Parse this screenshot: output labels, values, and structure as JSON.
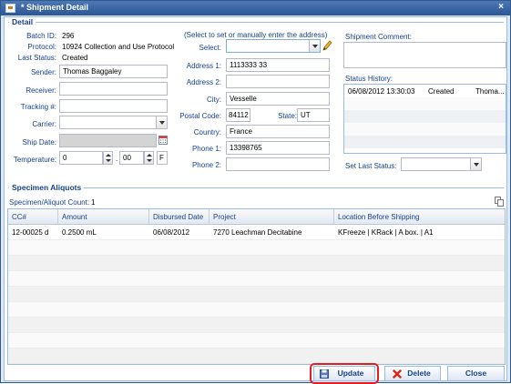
{
  "window": {
    "title": "* Shipment Detail",
    "close": "×"
  },
  "detail": {
    "legend": "Detail",
    "batch": {
      "label": "Batch ID:",
      "value": "296"
    },
    "protocol": {
      "label": "Protocol:",
      "value": "10924 Collection and Use Protocol"
    },
    "last_status": {
      "label": "Last Status:",
      "value": "Created"
    },
    "sender": {
      "label": "Sender:",
      "value": "Thomas Baggaley"
    },
    "receiver": {
      "label": "Receiver:",
      "value": ""
    },
    "tracking": {
      "label": "Tracking #:",
      "value": ""
    },
    "carrier": {
      "label": "Carrier:",
      "value": ""
    },
    "ship_date": {
      "label": "Ship Date:",
      "value": ""
    },
    "temperature": {
      "label": "Temperature:",
      "whole": "0",
      "dot": ".",
      "fraction": "00",
      "unit": "F"
    },
    "address_hint": "(Select to set or manually enter the address)",
    "select": {
      "label": "Select:",
      "value": ""
    },
    "address1": {
      "label": "Address 1:",
      "value": "1113333 33"
    },
    "address2": {
      "label": "Address 2:",
      "value": ""
    },
    "city": {
      "label": "City:",
      "value": "Vesselle"
    },
    "postal": {
      "label": "Postal Code:",
      "value": "84112"
    },
    "state": {
      "label": "State:",
      "value": "UT"
    },
    "country": {
      "label": "Country:",
      "value": "France"
    },
    "phone1": {
      "label": "Phone 1:",
      "value": "13398765"
    },
    "phone2": {
      "label": "Phone 2:",
      "value": ""
    },
    "shipment_comment": {
      "label": "Shipment Comment:",
      "value": ""
    },
    "status_history": {
      "label": "Status History:",
      "rows": [
        {
          "date": "06/08/2012 13:30:03",
          "status": "Created",
          "user": "Thoma..."
        }
      ]
    },
    "set_last_status": {
      "label": "Set Last Status:",
      "value": ""
    }
  },
  "aliquots": {
    "legend": "Specimen Aliquots",
    "count_label": "Specimen/Aliquot Count:",
    "count_value": "1",
    "columns": [
      "CC#",
      "Amount",
      "Disbursed Date",
      "Project",
      "Location Before Shipping"
    ],
    "rows": [
      {
        "cc": "12-00025 d",
        "amount": "0.2500 mL",
        "date": "06/08/2012",
        "project": "7270 Leachman Decitabine",
        "location": "KFreeze | KRack | A box. | A1"
      }
    ]
  },
  "buttons": {
    "update": "Update",
    "delete": "Delete",
    "close": "Close"
  },
  "colors": {
    "title_bar": "#2b5797",
    "label": "#15428b",
    "highlight": "#e02020",
    "delete_icon": "#d9261c"
  }
}
